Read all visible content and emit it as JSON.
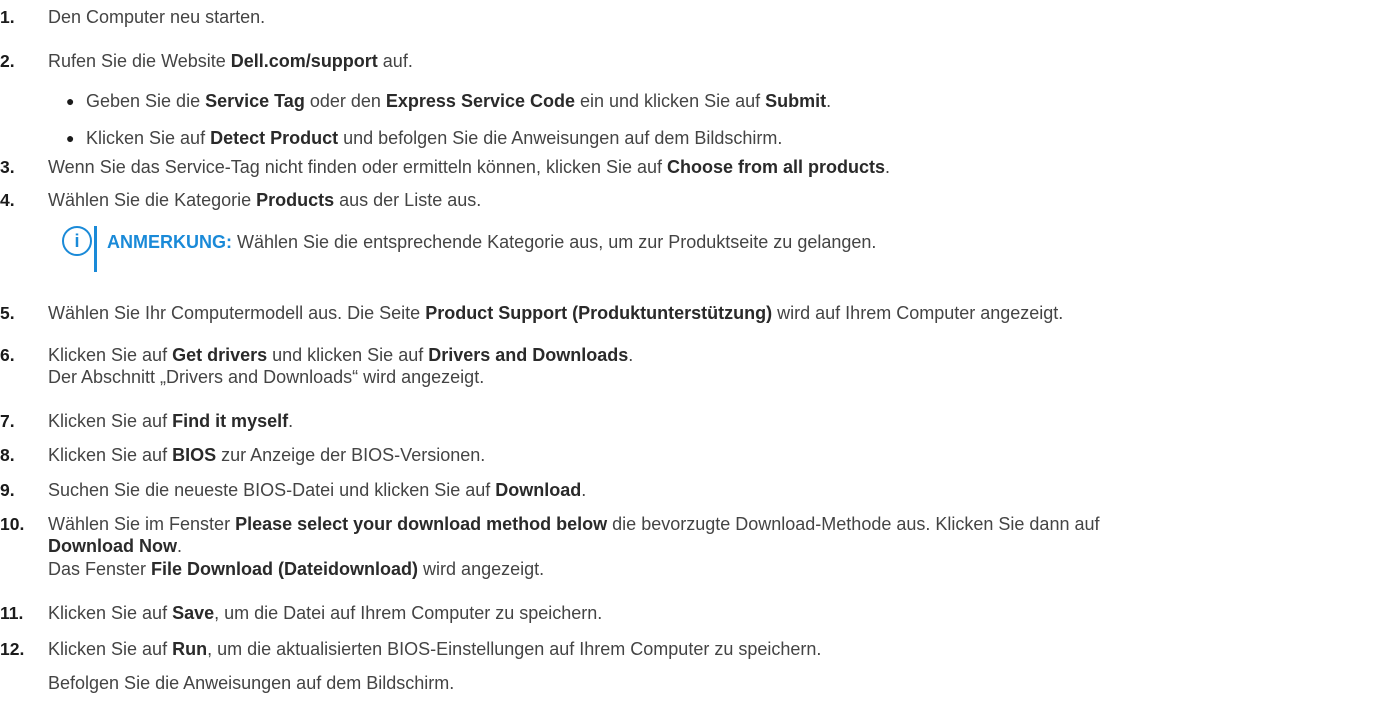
{
  "steps": [
    {
      "num": "1.",
      "parts": [
        {
          "t": "Den Computer neu starten.",
          "b": false
        }
      ]
    },
    {
      "num": "2.",
      "parts": [
        {
          "t": "Rufen Sie die Website ",
          "b": false
        },
        {
          "t": "Dell.com/support",
          "b": true
        },
        {
          "t": " auf.",
          "b": false
        }
      ]
    },
    {
      "num": "3.",
      "parts": [
        {
          "t": "Wenn Sie das Service-Tag nicht finden oder ermitteln können, klicken Sie auf ",
          "b": false
        },
        {
          "t": "Choose from all products",
          "b": true
        },
        {
          "t": ".",
          "b": false
        }
      ]
    },
    {
      "num": "4.",
      "parts": [
        {
          "t": "Wählen Sie die Kategorie ",
          "b": false
        },
        {
          "t": "Products",
          "b": true
        },
        {
          "t": " aus der Liste aus.",
          "b": false
        }
      ]
    },
    {
      "num": "5.",
      "parts": [
        {
          "t": "Wählen Sie Ihr Computermodell aus. Die Seite ",
          "b": false
        },
        {
          "t": "Product Support (Produktunterstützung)",
          "b": true
        },
        {
          "t": " wird auf Ihrem Computer angezeigt.",
          "b": false
        }
      ]
    },
    {
      "num": "6.",
      "parts": [
        {
          "t": "Klicken Sie auf ",
          "b": false
        },
        {
          "t": "Get drivers",
          "b": true
        },
        {
          "t": " und klicken Sie auf ",
          "b": false
        },
        {
          "t": "Drivers and Downloads",
          "b": true
        },
        {
          "t": ".",
          "b": false
        }
      ]
    },
    {
      "num": "7.",
      "parts": [
        {
          "t": "Klicken Sie auf ",
          "b": false
        },
        {
          "t": "Find it myself",
          "b": true
        },
        {
          "t": ".",
          "b": false
        }
      ]
    },
    {
      "num": "8.",
      "parts": [
        {
          "t": "Klicken Sie auf ",
          "b": false
        },
        {
          "t": "BIOS",
          "b": true
        },
        {
          "t": " zur Anzeige der BIOS-Versionen.",
          "b": false
        }
      ]
    },
    {
      "num": "9.",
      "parts": [
        {
          "t": "Suchen Sie die neueste BIOS-Datei und klicken Sie auf ",
          "b": false
        },
        {
          "t": "Download",
          "b": true
        },
        {
          "t": ".",
          "b": false
        }
      ]
    },
    {
      "num": "10.",
      "parts": [
        {
          "t": "Wählen Sie im Fenster ",
          "b": false
        },
        {
          "t": "Please select your download method below",
          "b": true
        },
        {
          "t": " die bevorzugte Download-Methode aus. Klicken Sie dann auf",
          "b": false
        }
      ]
    },
    {
      "num": "11.",
      "parts": [
        {
          "t": "Klicken Sie auf ",
          "b": false
        },
        {
          "t": "Save",
          "b": true
        },
        {
          "t": ", um die Datei auf Ihrem Computer zu speichern.",
          "b": false
        }
      ]
    },
    {
      "num": "12.",
      "parts": [
        {
          "t": "Klicken Sie auf ",
          "b": false
        },
        {
          "t": "Run",
          "b": true
        },
        {
          "t": ", um die aktualisierten BIOS-Einstellungen auf Ihrem Computer zu speichern.",
          "b": false
        }
      ]
    }
  ],
  "bullets": [
    {
      "parts": [
        {
          "t": "Geben Sie die ",
          "b": false
        },
        {
          "t": "Service Tag",
          "b": true
        },
        {
          "t": " oder den ",
          "b": false
        },
        {
          "t": "Express Service Code",
          "b": true
        },
        {
          "t": " ein und klicken Sie auf ",
          "b": false
        },
        {
          "t": "Submit",
          "b": true
        },
        {
          "t": ".",
          "b": false
        }
      ]
    },
    {
      "parts": [
        {
          "t": "Klicken Sie auf ",
          "b": false
        },
        {
          "t": "Detect Product",
          "b": true
        },
        {
          "t": " und befolgen Sie die Anweisungen auf dem Bildschirm.",
          "b": false
        }
      ]
    }
  ],
  "bullet_glyph": "●",
  "continuations": [
    {
      "parts": [
        {
          "t": "Der Abschnitt „Drivers and Downloads“ wird angezeigt.",
          "b": false
        }
      ]
    },
    {
      "parts": [
        {
          "t": "Download Now",
          "b": true
        },
        {
          "t": ".",
          "b": false
        }
      ]
    },
    {
      "parts": [
        {
          "t": "Das Fenster ",
          "b": false
        },
        {
          "t": "File Download (Dateidownload)",
          "b": true
        },
        {
          "t": " wird angezeigt.",
          "b": false
        }
      ]
    },
    {
      "parts": [
        {
          "t": "Befolgen Sie die Anweisungen auf dem Bildschirm.",
          "b": false
        }
      ]
    }
  ],
  "note": {
    "icon": "info-circle-icon",
    "icon_glyph": "i",
    "label": "ANMERKUNG:",
    "text": " Wählen Sie die entsprechende Kategorie aus, um zur Produktseite zu gelangen.",
    "accent_color": "#1a8ad8"
  }
}
